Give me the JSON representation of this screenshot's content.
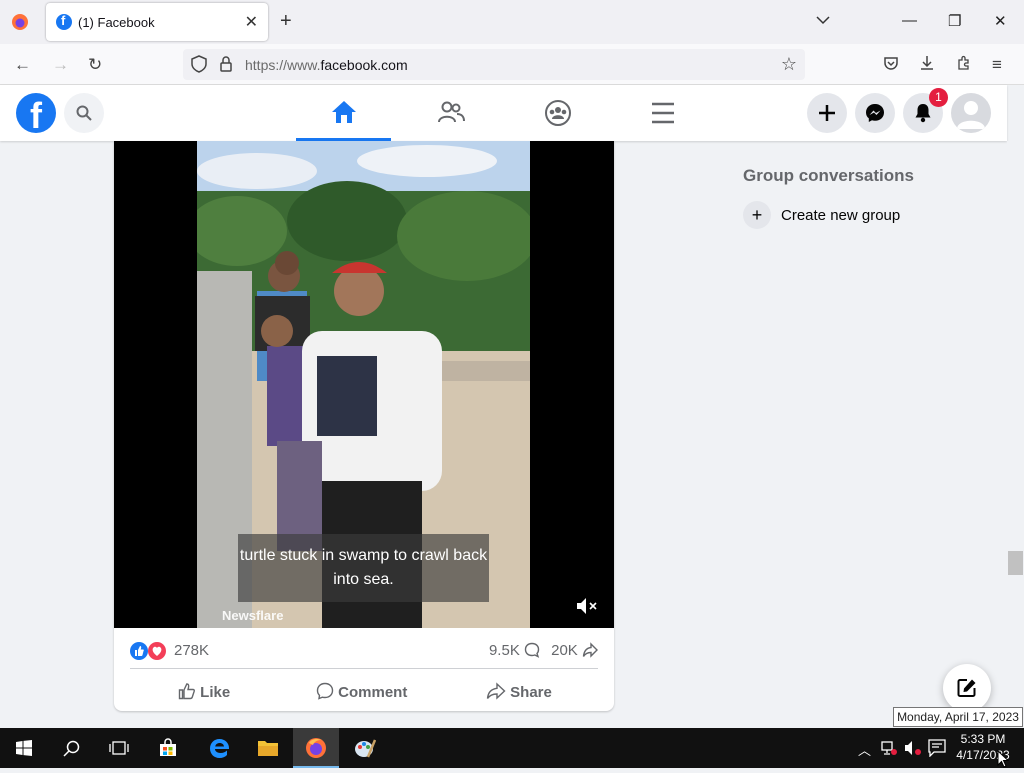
{
  "browser": {
    "tab_title": "(1) Facebook",
    "url_prefix": "https://www.",
    "url_domain": "facebook.com"
  },
  "facebook": {
    "notification_count": "1",
    "sidebar": {
      "title": "Group conversations",
      "create_group_label": "Create new group"
    },
    "post": {
      "caption": "turtle stuck in swamp to crawl back into sea.",
      "watermark": "Newsflare",
      "reactions_count": "278K",
      "comments_count": "9.5K",
      "shares_count": "20K",
      "like_label": "Like",
      "comment_label": "Comment",
      "share_label": "Share"
    },
    "colors": {
      "brand": "#1877f2",
      "badge": "#e41e3f"
    }
  },
  "taskbar": {
    "time": "5:33 PM",
    "date": "4/17/2023",
    "tooltip": "Monday, April 17, 2023"
  }
}
